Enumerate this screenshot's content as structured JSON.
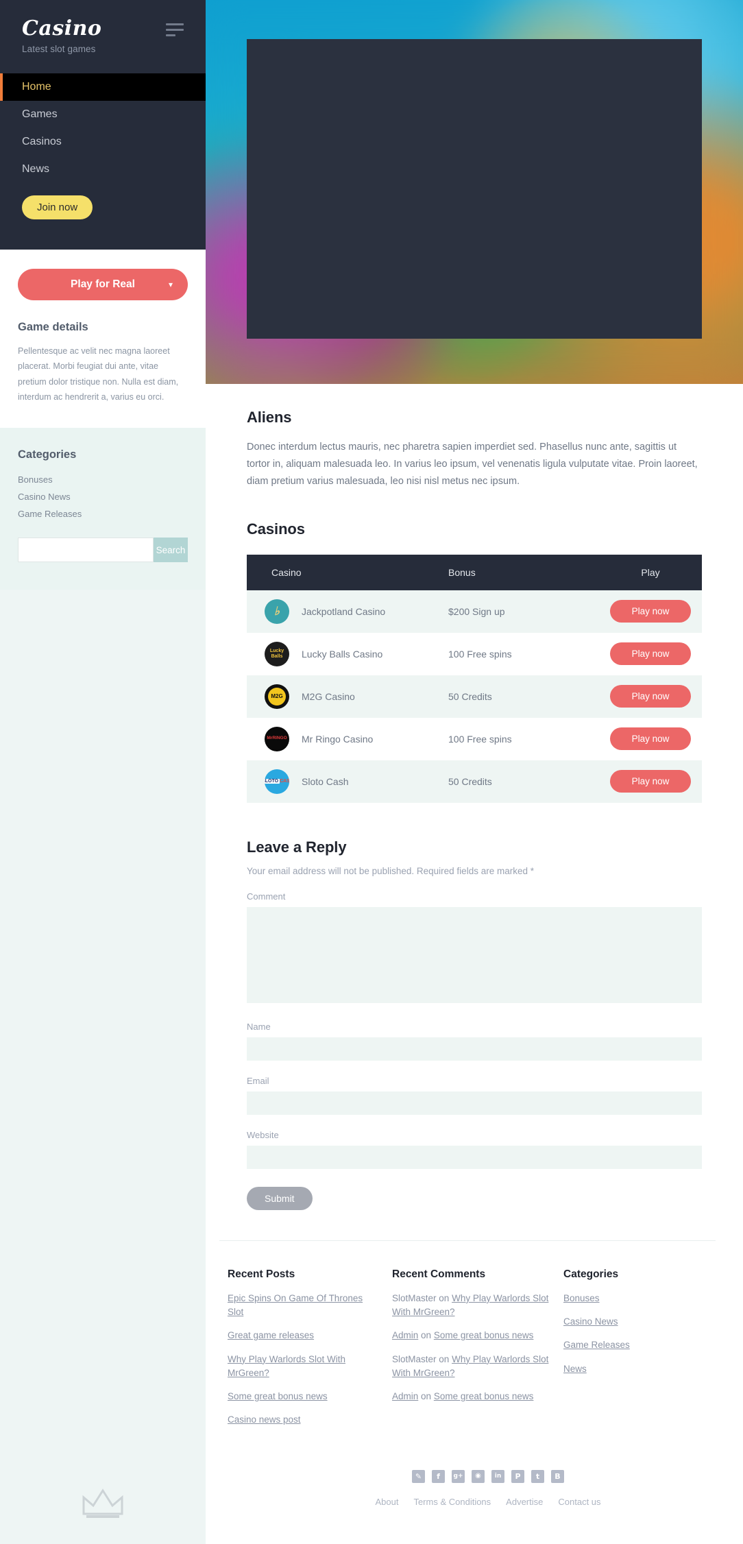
{
  "sidebar": {
    "brand": {
      "title": "Casino",
      "subtitle": "Latest slot games",
      "menu_icon": "hamburger-icon"
    },
    "nav": [
      {
        "label": "Home",
        "active": true
      },
      {
        "label": "Games",
        "active": false
      },
      {
        "label": "Casinos",
        "active": false
      },
      {
        "label": "News",
        "active": false
      }
    ],
    "join_label": "Join now",
    "play_real_label": "Play for Real",
    "chevron": "⌄",
    "game_details_heading": "Game details",
    "game_details_text": "Pellentesque ac velit nec magna laoreet placerat. Morbi feugiat dui ante, vitae pretium dolor tristique non. Nulla est diam, interdum ac hendrerit a, varius eu orci.",
    "categories_heading": "Categories",
    "categories": [
      "Bonuses",
      "Casino News",
      "Game Releases"
    ],
    "search": {
      "value": "",
      "placeholder": "",
      "button_label": "Search"
    },
    "crown_icon": "crown-icon"
  },
  "main": {
    "article_title": "Aliens",
    "article_text": "Donec interdum lectus mauris, nec pharetra sapien imperdiet sed. Phasellus nunc ante, sagittis ut tortor in, aliquam malesuada leo. In varius leo ipsum, vel venenatis ligula vulputate vitae. Proin laoreet, diam pretium varius malesuada, leo nisi nisl metus nec ipsum.",
    "casinos_title": "Casinos",
    "table": {
      "columns": [
        "Casino",
        "Bonus",
        "Play"
      ],
      "rows": [
        {
          "name": "Jackpotland Casino",
          "bonus": "$200 Sign up",
          "action": "Play now",
          "logo": "jackpotland-logo",
          "logo_text": "J"
        },
        {
          "name": "Lucky Balls Casino",
          "bonus": "100 Free spins",
          "action": "Play now",
          "logo": "luckyballs-logo",
          "logo_text": "Lucky Balls"
        },
        {
          "name": "M2G Casino",
          "bonus": "50 Credits",
          "action": "Play now",
          "logo": "m2g-logo",
          "logo_text": "M2G"
        },
        {
          "name": "Mr Ringo Casino",
          "bonus": "100 Free spins",
          "action": "Play now",
          "logo": "mrringo-logo",
          "logo_text": "MrRINGO"
        },
        {
          "name": "Sloto Cash",
          "bonus": "50 Credits",
          "action": "Play now",
          "logo": "slotocash-logo",
          "logo_text": "SLOTO CASH"
        }
      ]
    },
    "reply": {
      "title": "Leave a Reply",
      "note": "Your email address will not be published. Required fields are marked *",
      "comment_label": "Comment",
      "comment_value": "",
      "name_label": "Name",
      "name_value": "",
      "email_label": "Email",
      "email_value": "",
      "website_label": "Website",
      "website_value": "",
      "submit_label": "Submit"
    }
  },
  "footer": {
    "recent_posts_heading": "Recent Posts",
    "recent_posts": [
      "Epic Spins On Game Of Thrones Slot",
      "Great game releases",
      "Why Play Warlords Slot With MrGreen?",
      "Some great bonus news",
      "Casino news post"
    ],
    "recent_comments_heading": "Recent Comments",
    "recent_comments": [
      {
        "author": "SlotMaster",
        "on": "on",
        "post": "Why Play Warlords Slot With MrGreen?",
        "author_link": false
      },
      {
        "author": "Admin",
        "on": "on",
        "post": "Some great bonus news",
        "author_link": true
      },
      {
        "author": "SlotMaster",
        "on": "on",
        "post": "Why Play Warlords Slot With MrGreen?",
        "author_link": false
      },
      {
        "author": "Admin",
        "on": "on",
        "post": "Some great bonus news",
        "author_link": true
      }
    ],
    "categories_heading": "Categories",
    "categories": [
      "Bonuses",
      "Casino News",
      "Game Releases",
      "News"
    ],
    "social": [
      {
        "name": "twitter-icon",
        "glyph": "🐦"
      },
      {
        "name": "facebook-icon",
        "glyph": "f"
      },
      {
        "name": "google-plus-icon",
        "glyph": "g+"
      },
      {
        "name": "instagram-icon",
        "glyph": "◉"
      },
      {
        "name": "linkedin-icon",
        "glyph": "in"
      },
      {
        "name": "pinterest-icon",
        "glyph": "P"
      },
      {
        "name": "tumblr-icon",
        "glyph": "t"
      },
      {
        "name": "blogger-icon",
        "glyph": "B"
      }
    ],
    "bottom_links": [
      "About",
      "Terms & Conditions",
      "Advertise",
      "Contact us"
    ]
  },
  "colors": {
    "sidebar_dark": "#262c3a",
    "accent_red": "#ec6767",
    "accent_yellow": "#f5e06a",
    "active_gold": "#e8c56a",
    "orange_bar": "#f07d3a",
    "teal_bg": "#eef5f3",
    "search_btn": "#b2d5d4",
    "submit_grey": "#a5a9b2"
  }
}
